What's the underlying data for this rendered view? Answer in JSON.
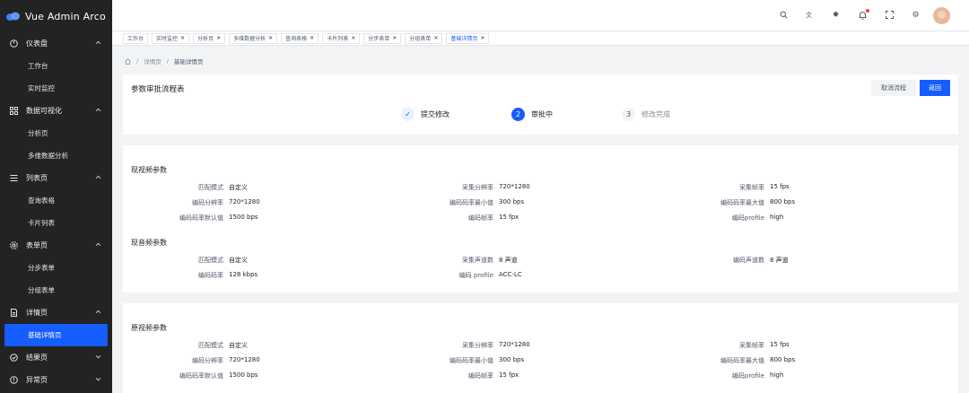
{
  "app": {
    "title": "Vue Admin Arco"
  },
  "sidebar": {
    "groups": [
      {
        "label": "仪表盘",
        "icon": "dashboard-icon",
        "items": [
          "工作台",
          "实时监控"
        ]
      },
      {
        "label": "数据可视化",
        "icon": "apps-icon",
        "items": [
          "分析页",
          "多维数据分析"
        ]
      },
      {
        "label": "列表页",
        "icon": "list-icon",
        "items": [
          "查询表格",
          "卡片列表"
        ]
      },
      {
        "label": "表单页",
        "icon": "settings-icon",
        "items": [
          "分步表单",
          "分组表单"
        ]
      },
      {
        "label": "详情页",
        "icon": "file-icon",
        "items": [
          "基础详情页"
        ],
        "active_item": "基础详情页"
      },
      {
        "label": "结果页",
        "icon": "check-circle-icon",
        "items": []
      },
      {
        "label": "异常页",
        "icon": "exclamation-circle-icon",
        "items": []
      }
    ]
  },
  "topbar": {
    "icons": [
      "search-icon",
      "language-icon",
      "theme-icon",
      "notification-icon",
      "fullscreen-icon",
      "settings-icon"
    ],
    "notification_dot_color": "#f53f3f"
  },
  "tabs": [
    {
      "label": "工作台",
      "closable": false
    },
    {
      "label": "实时监控",
      "closable": true
    },
    {
      "label": "分析页",
      "closable": true
    },
    {
      "label": "多维数据分析",
      "closable": true
    },
    {
      "label": "查询表格",
      "closable": true
    },
    {
      "label": "卡片列表",
      "closable": true
    },
    {
      "label": "分步表单",
      "closable": true
    },
    {
      "label": "分组表单",
      "closable": true
    },
    {
      "label": "基础详情页",
      "closable": true,
      "active": true
    }
  ],
  "breadcrumb": {
    "items": [
      "详情页",
      "基础详情页"
    ]
  },
  "flow": {
    "title": "参数审批流程表",
    "cancel_label": "取消流程",
    "back_label": "返回",
    "steps": [
      {
        "num": "✓",
        "label": "提交修改",
        "status": "done"
      },
      {
        "num": "2",
        "label": "审批中",
        "status": "process"
      },
      {
        "num": "3",
        "label": "修改完成",
        "status": "wait"
      }
    ]
  },
  "current": {
    "video_title": "现视频参数",
    "video": [
      [
        {
          "k": "匹配模式",
          "v": "自定义"
        },
        {
          "k": "采集分辨率",
          "v": "720*1280"
        },
        {
          "k": "采集帧率",
          "v": "15 fps"
        }
      ],
      [
        {
          "k": "编码分辨率",
          "v": "720*1280"
        },
        {
          "k": "编码码率最小值",
          "v": "300 bps"
        },
        {
          "k": "编码码率最大值",
          "v": "800 bps"
        }
      ],
      [
        {
          "k": "编码码率默认值",
          "v": "1500 bps"
        },
        {
          "k": "编码帧率",
          "v": "15 fpx"
        },
        {
          "k": "编码profile",
          "v": "high"
        }
      ]
    ],
    "audio_title": "现音频参数",
    "audio": [
      [
        {
          "k": "匹配模式",
          "v": "自定义"
        },
        {
          "k": "采集声道数",
          "v": "8 声道"
        },
        {
          "k": "编码声道数",
          "v": "8 声道"
        }
      ],
      [
        {
          "k": "编码码率",
          "v": "128 kbps"
        },
        {
          "k": "编码 profile",
          "v": "ACC-LC"
        }
      ]
    ]
  },
  "original": {
    "video_title": "原视频参数",
    "video": [
      [
        {
          "k": "匹配模式",
          "v": "自定义"
        },
        {
          "k": "采集分辨率",
          "v": "720*1280"
        },
        {
          "k": "采集帧率",
          "v": "15 fps"
        }
      ],
      [
        {
          "k": "编码分辨率",
          "v": "720*1280"
        },
        {
          "k": "编码码率最小值",
          "v": "300 bps"
        },
        {
          "k": "编码码率最大值",
          "v": "800 bps"
        }
      ],
      [
        {
          "k": "编码码率默认值",
          "v": "1500 bps"
        },
        {
          "k": "编码帧率",
          "v": "15 fpx"
        },
        {
          "k": "编码profile",
          "v": "high"
        }
      ]
    ]
  },
  "colors": {
    "primary": "#165dff",
    "sidebar_bg": "#232324",
    "page_bg": "#f2f3f5"
  }
}
